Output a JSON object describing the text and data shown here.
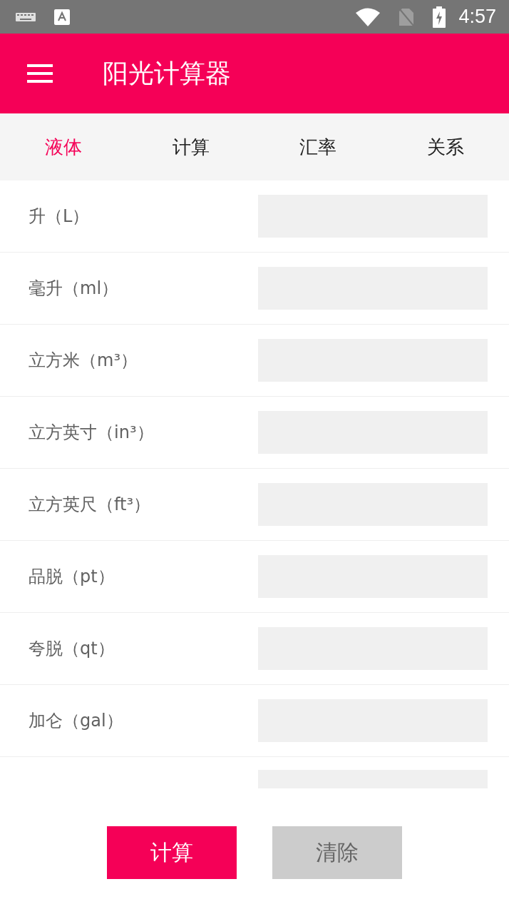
{
  "status_bar": {
    "time": "4:57"
  },
  "app_bar": {
    "title": "阳光计算器"
  },
  "tabs": [
    {
      "label": "液体",
      "selected": true
    },
    {
      "label": "计算",
      "selected": false
    },
    {
      "label": "汇率",
      "selected": false
    },
    {
      "label": "关系",
      "selected": false
    }
  ],
  "units": [
    {
      "label": "升（L）"
    },
    {
      "label": "毫升（ml）"
    },
    {
      "label": "立方米（m³）"
    },
    {
      "label": "立方英寸（in³）"
    },
    {
      "label": "立方英尺（ft³）"
    },
    {
      "label": "品脱（pt）"
    },
    {
      "label": "夸脱（qt）"
    },
    {
      "label": "加仑（gal）"
    },
    {
      "kind": "cut_off"
    }
  ],
  "buttons": [
    {
      "label": "计算",
      "kind": "primary"
    },
    {
      "label": "清除",
      "kind": "secondary"
    }
  ]
}
